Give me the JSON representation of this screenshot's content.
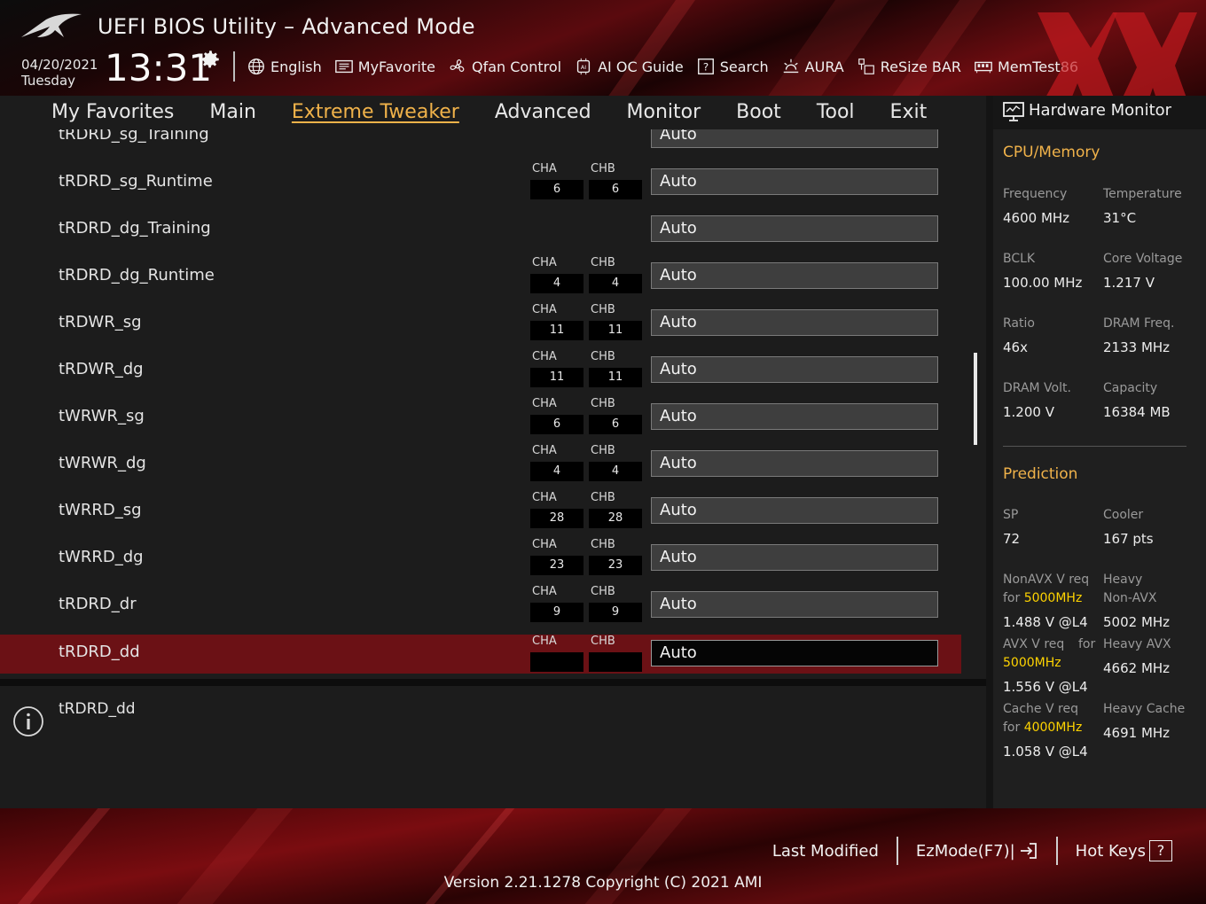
{
  "header": {
    "title": "UEFI BIOS Utility – Advanced Mode",
    "date": "04/20/2021",
    "day": "Tuesday",
    "time": "13:31",
    "toolbar": [
      {
        "label": "English",
        "icon": "globe-icon"
      },
      {
        "label": "MyFavorite",
        "icon": "favorite-list-icon"
      },
      {
        "label": "Qfan Control",
        "icon": "fan-icon"
      },
      {
        "label": "AI OC Guide",
        "icon": "ai-chip-icon"
      },
      {
        "label": "Search",
        "icon": "search-help-icon"
      },
      {
        "label": "AURA",
        "icon": "aura-light-icon"
      },
      {
        "label": "ReSize BAR",
        "icon": "resize-bar-icon"
      },
      {
        "label": "MemTest86",
        "icon": "memory-icon"
      }
    ]
  },
  "nav": {
    "tabs": [
      "My Favorites",
      "Main",
      "Extreme Tweaker",
      "Advanced",
      "Monitor",
      "Boot",
      "Tool",
      "Exit"
    ],
    "active": "Extreme Tweaker"
  },
  "settings": {
    "cha_label": "CHA",
    "chb_label": "CHB",
    "rows": [
      {
        "label": "tRDRD_sg_Training",
        "cha": "",
        "chb": "",
        "value": "Auto",
        "partial": true
      },
      {
        "label": "tRDRD_sg_Runtime",
        "cha": "6",
        "chb": "6",
        "value": "Auto"
      },
      {
        "label": "tRDRD_dg_Training",
        "cha": null,
        "chb": null,
        "value": "Auto"
      },
      {
        "label": "tRDRD_dg_Runtime",
        "cha": "4",
        "chb": "4",
        "value": "Auto"
      },
      {
        "label": "tRDWR_sg",
        "cha": "11",
        "chb": "11",
        "value": "Auto"
      },
      {
        "label": "tRDWR_dg",
        "cha": "11",
        "chb": "11",
        "value": "Auto"
      },
      {
        "label": "tWRWR_sg",
        "cha": "6",
        "chb": "6",
        "value": "Auto"
      },
      {
        "label": "tWRWR_dg",
        "cha": "4",
        "chb": "4",
        "value": "Auto"
      },
      {
        "label": "tWRRD_sg",
        "cha": "28",
        "chb": "28",
        "value": "Auto"
      },
      {
        "label": "tWRRD_dg",
        "cha": "23",
        "chb": "23",
        "value": "Auto"
      },
      {
        "label": "tRDRD_dr",
        "cha": "9",
        "chb": "9",
        "value": "Auto"
      },
      {
        "label": "tRDRD_dd",
        "cha": "",
        "chb": "",
        "value": "Auto",
        "selected": true
      }
    ]
  },
  "help": {
    "text": "tRDRD_dd"
  },
  "hw_monitor": {
    "title": "Hardware Monitor",
    "cpu_section": "CPU/Memory",
    "frequency_label": "Frequency",
    "frequency_value": "4600 MHz",
    "temperature_label": "Temperature",
    "temperature_value": "31°C",
    "bclk_label": "BCLK",
    "bclk_value": "100.00 MHz",
    "core_voltage_label": "Core Voltage",
    "core_voltage_value": "1.217 V",
    "ratio_label": "Ratio",
    "ratio_value": "46x",
    "dram_freq_label": "DRAM Freq.",
    "dram_freq_value": "2133 MHz",
    "dram_volt_label": "DRAM Volt.",
    "dram_volt_value": "1.200 V",
    "capacity_label": "Capacity",
    "capacity_value": "16384 MB",
    "prediction_section": "Prediction",
    "sp_label": "SP",
    "sp_value": "72",
    "cooler_label": "Cooler",
    "cooler_value": "167 pts",
    "nonavx_label": "NonAVX V req",
    "nonavx_for": "for",
    "nonavx_freq": "5000MHz",
    "nonavx_value": "1.488 V @L4",
    "heavy_nonavx_label1": "Heavy",
    "heavy_nonavx_label2": "Non-AVX",
    "heavy_nonavx_value": "5002 MHz",
    "avx_label": "AVX V req",
    "avx_for": "for",
    "avx_freq": "5000MHz",
    "avx_value": "1.556 V @L4",
    "heavy_avx_label": "Heavy AVX",
    "heavy_avx_value": "4662 MHz",
    "cache_label": "Cache V req",
    "cache_for": "for",
    "cache_freq": "4000MHz",
    "cache_value": "1.058 V @L4",
    "heavy_cache_label": "Heavy Cache",
    "heavy_cache_value": "4691 MHz"
  },
  "footer": {
    "last_modified": "Last Modified",
    "ezmode": "EzMode(F7)|",
    "hotkeys": "Hot Keys",
    "hotkeys_badge": "?",
    "version": "Version 2.21.1278 Copyright (C) 2021 AMI"
  },
  "colors": {
    "accent": "#f0b24a",
    "highlight": "#ffd400",
    "selected_row": "#6b1115",
    "brand_red": "#7a0c10"
  }
}
